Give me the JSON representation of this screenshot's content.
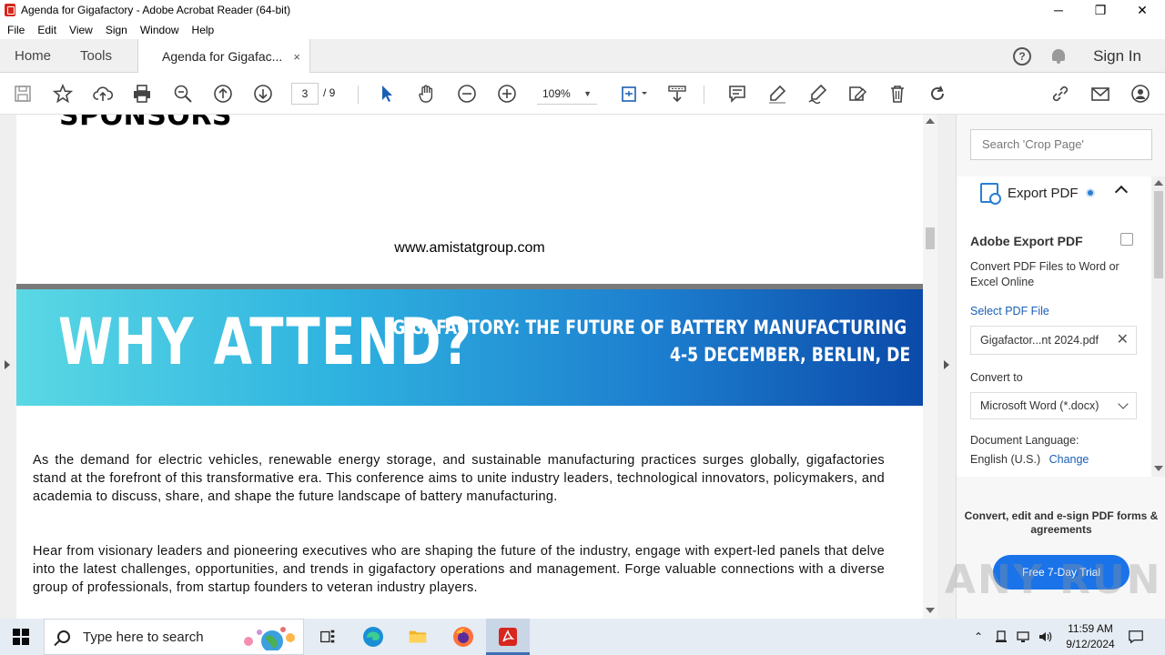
{
  "window": {
    "title": "Agenda for Gigafactory - Adobe Acrobat Reader (64-bit)",
    "minimize": "─",
    "maximize": "❐",
    "close": "✕"
  },
  "menu": [
    "File",
    "Edit",
    "View",
    "Sign",
    "Window",
    "Help"
  ],
  "tabs": {
    "home": "Home",
    "tools": "Tools",
    "document": "Agenda for Gigafac...",
    "close": "×",
    "help": "?",
    "signin": "Sign In"
  },
  "toolbar": {
    "page_current": "3",
    "page_total": "/ 9",
    "zoom": "109%",
    "zoom_chevron": "▼"
  },
  "document": {
    "sponsors_heading": "SPONSORS",
    "website": "www.amistatgroup.com",
    "banner_title": "WHY ATTEND?",
    "banner_line1": "GIGAFACTORY: THE FUTURE OF BATTERY MANUFACTURING",
    "banner_line2": "4-5 DECEMBER, BERLIN, DE",
    "paragraph1": "As the demand for electric vehicles, renewable energy storage, and sustainable manufacturing practices surges globally, gigafactories stand at the forefront of this transformative era. This conference aims to unite industry leaders, technological innovators, policymakers, and academia to discuss, share, and shape the future landscape of battery manufacturing.",
    "paragraph2": " Hear from visionary leaders and pioneering executives who are shaping the future of the industry, engage with expert-led panels that delve into the latest challenges, opportunities, and trends in gigafactory operations and management. Forge valuable connections with a diverse group of professionals, from startup founders to veteran industry players."
  },
  "right_pane": {
    "search_placeholder": "Search 'Crop Page'",
    "export_title": "Export PDF",
    "adobe_export_title": "Adobe Export PDF",
    "adobe_export_desc": "Convert PDF Files to Word or Excel Online",
    "select_pdf": "Select PDF File",
    "file_name": "Gigafactor...nt 2024.pdf",
    "file_clear": "✕",
    "convert_to_label": "Convert to",
    "convert_to_value": "Microsoft Word (*.docx)",
    "doc_language_label": "Document Language:",
    "doc_language_value": "English (U.S.)",
    "change": "Change",
    "promo": "Convert, edit and e-sign PDF forms & agreements",
    "trial_button": "Free 7-Day Trial"
  },
  "watermark": "ANY RUN",
  "taskbar": {
    "search_placeholder": "Type here to search",
    "time": "11:59 AM",
    "date": "9/12/2024"
  },
  "colors": {
    "banner_start": "#5ad8e4",
    "banner_end": "#0b4aa9",
    "link": "#1a5fb4",
    "acrobat_red": "#d7261e"
  }
}
